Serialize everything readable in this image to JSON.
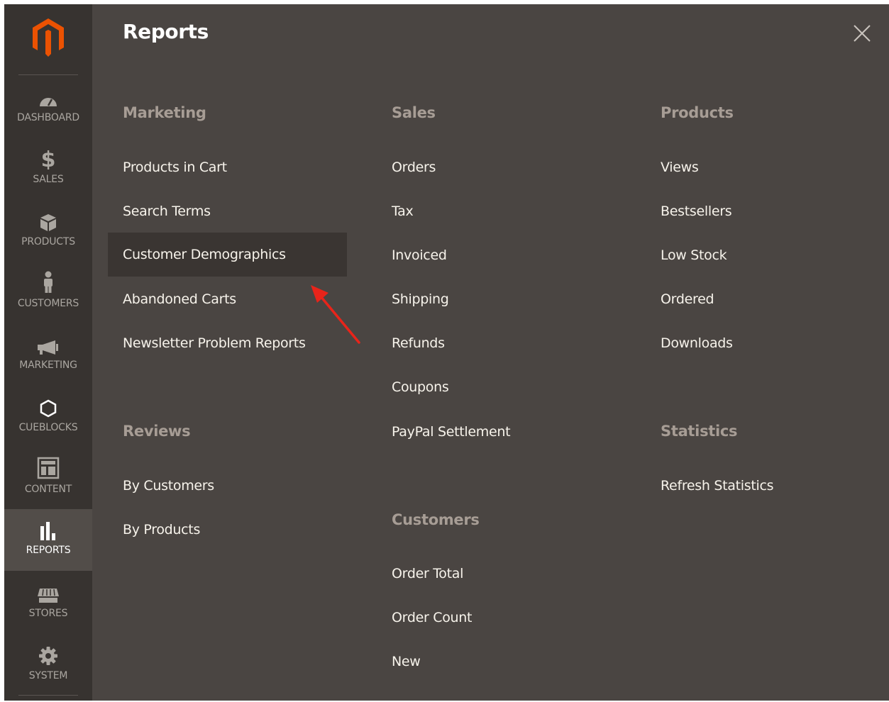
{
  "sidebar": {
    "items": [
      {
        "label": "DASHBOARD",
        "icon": "dashboard-icon"
      },
      {
        "label": "SALES",
        "icon": "dollar-icon"
      },
      {
        "label": "PRODUCTS",
        "icon": "box-icon"
      },
      {
        "label": "CUSTOMERS",
        "icon": "person-icon"
      },
      {
        "label": "MARKETING",
        "icon": "megaphone-icon"
      },
      {
        "label": "CUEBLOCKS",
        "icon": "hexagon-icon"
      },
      {
        "label": "CONTENT",
        "icon": "layout-icon"
      },
      {
        "label": "REPORTS",
        "icon": "bar-chart-icon",
        "active": true
      },
      {
        "label": "STORES",
        "icon": "store-icon"
      },
      {
        "label": "SYSTEM",
        "icon": "gear-icon"
      }
    ]
  },
  "panel": {
    "title": "Reports",
    "columns": {
      "marketing": {
        "heading": "Marketing",
        "links": [
          "Products in Cart",
          "Search Terms",
          "Customer Demographics",
          "Abandoned Carts",
          "Newsletter Problem Reports"
        ]
      },
      "reviews": {
        "heading": "Reviews",
        "links": [
          "By Customers",
          "By Products"
        ]
      },
      "sales": {
        "heading": "Sales",
        "links": [
          "Orders",
          "Tax",
          "Invoiced",
          "Shipping",
          "Refunds",
          "Coupons",
          "PayPal Settlement"
        ]
      },
      "customers": {
        "heading": "Customers",
        "links": [
          "Order Total",
          "Order Count",
          "New"
        ]
      },
      "products": {
        "heading": "Products",
        "links": [
          "Views",
          "Bestsellers",
          "Low Stock",
          "Ordered",
          "Downloads"
        ]
      },
      "statistics": {
        "heading": "Statistics",
        "links": [
          "Refresh Statistics"
        ]
      }
    },
    "highlighted_link": "Customer Demographics"
  },
  "colors": {
    "sidebar_bg": "#373330",
    "sidebar_active_bg": "#524d49",
    "panel_bg": "#4a4542",
    "heading_text": "#a79d95",
    "link_text": "#f7f3eb",
    "logo_orange": "#eb5202",
    "annotation_arrow": "#e8241a"
  }
}
